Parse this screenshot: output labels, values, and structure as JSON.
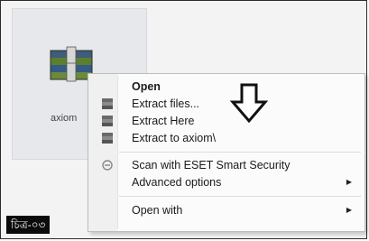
{
  "file": {
    "label": "axiom"
  },
  "menu": {
    "items": [
      {
        "label": "Open",
        "bold": true,
        "icon": "none"
      },
      {
        "label": "Extract files...",
        "icon": "archive-icon"
      },
      {
        "label": "Extract Here",
        "icon": "archive-icon"
      },
      {
        "label": "Extract to axiom\\",
        "icon": "archive-icon"
      },
      {
        "label": "Scan with ESET Smart Security",
        "icon": "eset-icon"
      },
      {
        "label": "Advanced options",
        "submenu": true
      },
      {
        "label": "Open with",
        "submenu": true
      }
    ]
  },
  "caption": {
    "label": "চিত্র-০৩"
  },
  "colors": {
    "caption_bg": "#0b0b0b",
    "menu_bg": "#fbfbfb"
  }
}
